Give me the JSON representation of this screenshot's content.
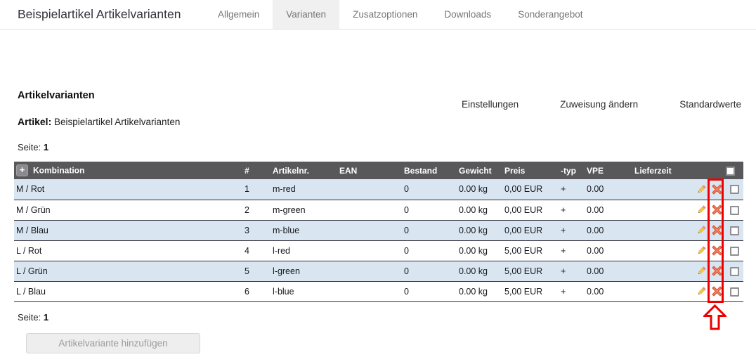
{
  "header": {
    "title": "Beispielartikel Artikelvarianten",
    "tabs": [
      {
        "label": "Allgemein"
      },
      {
        "label": "Varianten",
        "active": true
      },
      {
        "label": "Zusatzoptionen"
      },
      {
        "label": "Downloads"
      },
      {
        "label": "Sonderangebot"
      }
    ]
  },
  "toolbar": {
    "heading": "Artikelvarianten",
    "article_label": "Artikel:",
    "article_value": "Beispielartikel Artikelvarianten",
    "actions": [
      {
        "label": "Einstellungen"
      },
      {
        "label": "Zuweisung ändern"
      },
      {
        "label": "Standardwerte"
      }
    ]
  },
  "pagination_top": {
    "label": "Seite:",
    "page": "1"
  },
  "pagination_bottom": {
    "label": "Seite:",
    "page": "1"
  },
  "table": {
    "headers": [
      "Kombination",
      "#",
      "Artikelnr.",
      "EAN",
      "Bestand",
      "Gewicht",
      "Preis",
      "-typ",
      "VPE",
      "Lieferzeit"
    ],
    "rows": [
      {
        "kombination": "M / Rot",
        "nr": "1",
        "artikelnr": "m-red",
        "ean": "",
        "bestand": "0",
        "gewicht": "0.00 kg",
        "preis": "0,00 EUR",
        "typ": "+",
        "vpe": "0.00",
        "lieferzeit": ""
      },
      {
        "kombination": "M / Grün",
        "nr": "2",
        "artikelnr": "m-green",
        "ean": "",
        "bestand": "0",
        "gewicht": "0.00 kg",
        "preis": "0,00 EUR",
        "typ": "+",
        "vpe": "0.00",
        "lieferzeit": ""
      },
      {
        "kombination": "M / Blau",
        "nr": "3",
        "artikelnr": "m-blue",
        "ean": "",
        "bestand": "0",
        "gewicht": "0.00 kg",
        "preis": "0,00 EUR",
        "typ": "+",
        "vpe": "0.00",
        "lieferzeit": ""
      },
      {
        "kombination": "L / Rot",
        "nr": "4",
        "artikelnr": "l-red",
        "ean": "",
        "bestand": "0",
        "gewicht": "0.00 kg",
        "preis": "5,00 EUR",
        "typ": "+",
        "vpe": "0.00",
        "lieferzeit": ""
      },
      {
        "kombination": "L / Grün",
        "nr": "5",
        "artikelnr": "l-green",
        "ean": "",
        "bestand": "0",
        "gewicht": "0.00 kg",
        "preis": "5,00 EUR",
        "typ": "+",
        "vpe": "0.00",
        "lieferzeit": ""
      },
      {
        "kombination": "L / Blau",
        "nr": "6",
        "artikelnr": "l-blue",
        "ean": "",
        "bestand": "0",
        "gewicht": "0.00 kg",
        "preis": "5,00 EUR",
        "typ": "+",
        "vpe": "0.00",
        "lieferzeit": ""
      }
    ]
  },
  "footer": {
    "add_button": "Artikelvariante hinzufügen"
  },
  "icons": {
    "add_glyph": "+",
    "expand_all": "plus-icon",
    "edit": "pencil-icon",
    "delete": "red-x-icon",
    "row_select": "checkbox",
    "annotation": "red-up-arrow-and-frame"
  },
  "colors": {
    "table_header_bg": "#58585a",
    "row_alt_bg": "#d9e6f2",
    "row_border": "#2f2f38",
    "tab_active_bg": "#f0f0f0",
    "annotation_red": "#ee0000",
    "button_bg": "#eeeeee"
  }
}
